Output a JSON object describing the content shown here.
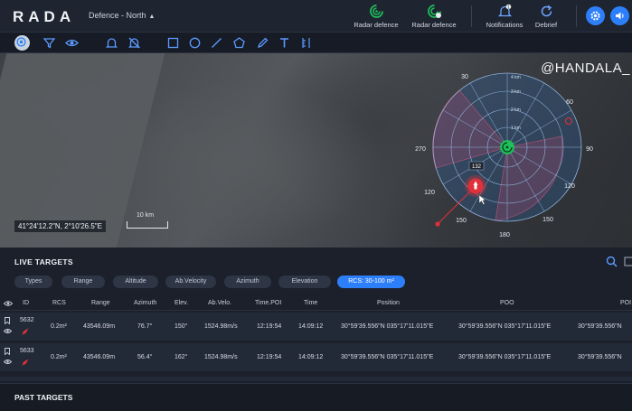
{
  "app": {
    "logo": "RADA",
    "region": "Defence - North"
  },
  "topbar": {
    "items": [
      {
        "label": "Radar defence",
        "icon": "radar-green-icon"
      },
      {
        "label": "Radar defence",
        "icon": "radar-green-alert-icon"
      },
      {
        "label": "Notifications",
        "icon": "bell-icon",
        "badge": "1"
      },
      {
        "label": "Debrief",
        "icon": "refresh-icon"
      }
    ],
    "settings_icon": "gear-icon",
    "sound_icon": "speaker-icon"
  },
  "toolbar": {
    "tools": [
      "layers-icon",
      "filter-icon",
      "eye-icon",
      "bell-icon",
      "bell-off-icon",
      "rectangle-icon",
      "circle-icon",
      "line-icon",
      "pentagon-icon",
      "pen-icon",
      "text-icon",
      "ruler-icon"
    ]
  },
  "map": {
    "watermark": "@HANDALA_",
    "coords": "41°24'12.2\"N, 2°10'26.5\"E",
    "scale_label": "10 km",
    "radar": {
      "bearing_labels": [
        "30",
        "60",
        "90",
        "120",
        "150",
        "180",
        "270",
        "120",
        "150"
      ],
      "range_labels": [
        "1 km",
        "2 km",
        "3 km",
        "4 km"
      ],
      "target_label": "132"
    }
  },
  "live_targets": {
    "title": "LIVE TARGETS",
    "filters": [
      {
        "label": "Types",
        "active": false
      },
      {
        "label": "Range",
        "active": false
      },
      {
        "label": "Altitude",
        "active": false
      },
      {
        "label": "Ab.Velocity",
        "active": false
      },
      {
        "label": "Azimuth",
        "active": false
      },
      {
        "label": "Elevation",
        "active": false
      },
      {
        "label": "RCS: 30-100 m²",
        "active": true
      }
    ],
    "columns": [
      "ID",
      "RCS",
      "Range",
      "Azimuth",
      "Elev.",
      "Ab.Velo.",
      "Time.POI",
      "Time",
      "Position",
      "POO",
      "POI"
    ],
    "rows": [
      {
        "id": "5632",
        "rcs": "0.2m²",
        "range": "43546.09m",
        "azimuth": "76.7°",
        "elev": "150°",
        "velo": "1524.98m/s",
        "time_poi": "12:19:54",
        "time": "14:09:12",
        "position": "30°59'39.556\"N   035°17'11.015\"E",
        "poo": "30°59'39.556\"N   035°17'11.015\"E",
        "poi": "30°59'39.556\"N"
      },
      {
        "id": "5633",
        "rcs": "0.2m²",
        "range": "43546.09m",
        "azimuth": "56.4°",
        "elev": "162°",
        "velo": "1524.98m/s",
        "time_poi": "12:19:54",
        "time": "14:09:12",
        "position": "30°59'39.556\"N   035°17'11.015\"E",
        "poo": "30°59'39.556\"N   035°17'11.015\"E",
        "poi": "30°59'39.556\"N"
      }
    ]
  },
  "past_targets": {
    "title": "PAST TARGETS"
  },
  "colors": {
    "accent": "#2d7ff9",
    "radar_green": "#1fbf5a",
    "threat_red": "#e0303a"
  }
}
